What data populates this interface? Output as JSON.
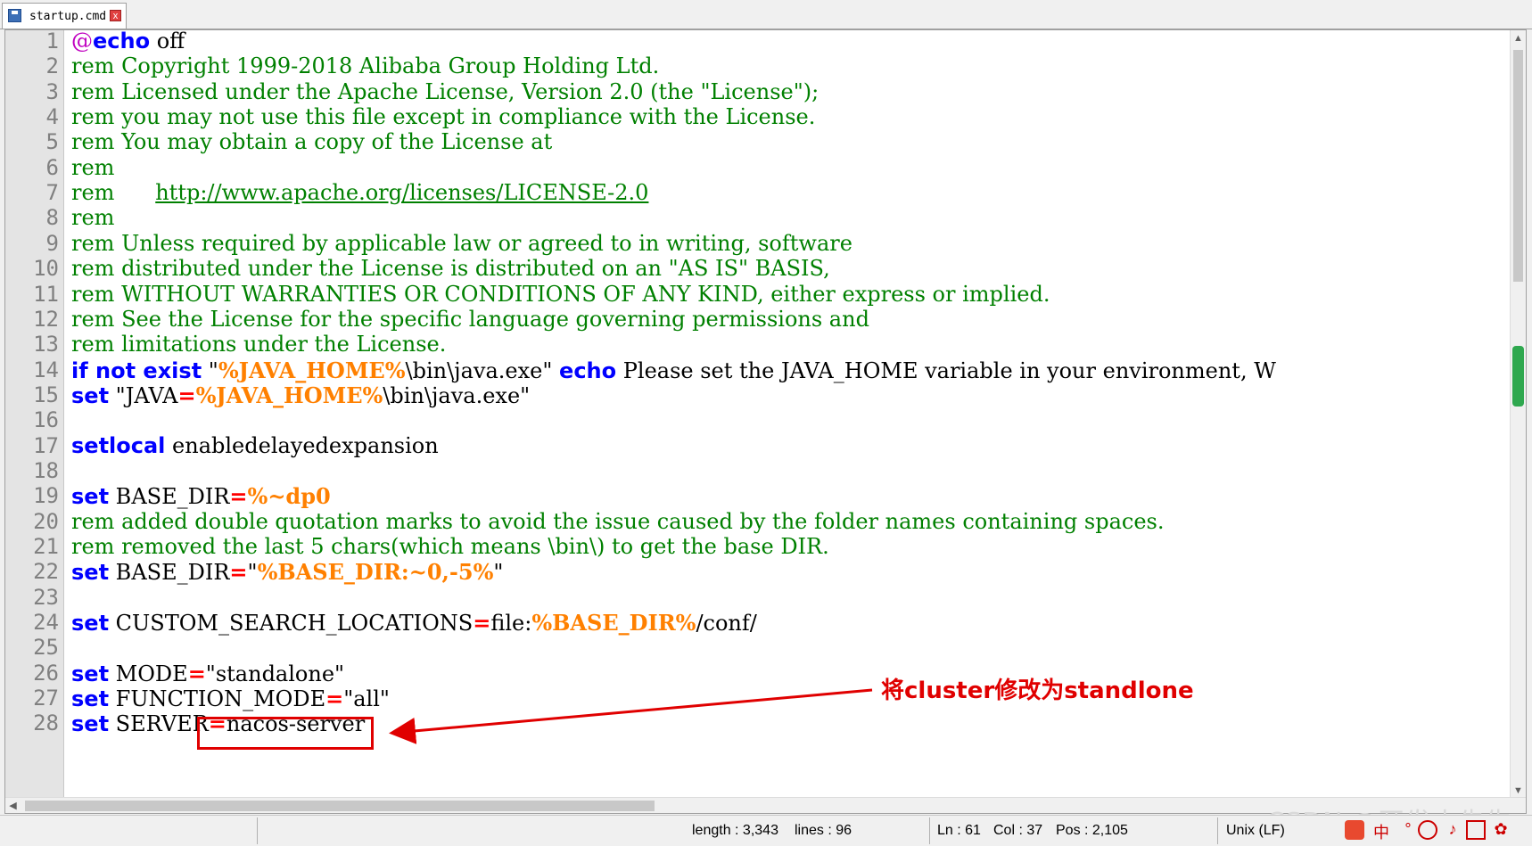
{
  "tab": {
    "label": "startup.cmd",
    "close_glyph": "x"
  },
  "lines": [
    {
      "n": "1",
      "segs": [
        {
          "c": "at",
          "t": "@"
        },
        {
          "c": "kw",
          "t": "echo"
        },
        {
          "c": "pl",
          "t": " off"
        }
      ]
    },
    {
      "n": "2",
      "segs": [
        {
          "c": "cm",
          "t": "rem Copyright 1999-2018 Alibaba Group Holding Ltd."
        }
      ]
    },
    {
      "n": "3",
      "segs": [
        {
          "c": "cm",
          "t": "rem Licensed under the Apache License, Version 2.0 (the \"License\");"
        }
      ]
    },
    {
      "n": "4",
      "segs": [
        {
          "c": "cm",
          "t": "rem you may not use this file except in compliance with the License."
        }
      ]
    },
    {
      "n": "5",
      "segs": [
        {
          "c": "cm",
          "t": "rem You may obtain a copy of the License at"
        }
      ]
    },
    {
      "n": "6",
      "segs": [
        {
          "c": "cm",
          "t": "rem"
        }
      ]
    },
    {
      "n": "7",
      "segs": [
        {
          "c": "cm",
          "t": "rem      "
        },
        {
          "c": "link",
          "t": "http://www.apache.org/licenses/LICENSE-2.0"
        }
      ]
    },
    {
      "n": "8",
      "segs": [
        {
          "c": "cm",
          "t": "rem"
        }
      ]
    },
    {
      "n": "9",
      "segs": [
        {
          "c": "cm",
          "t": "rem Unless required by applicable law or agreed to in writing, software"
        }
      ]
    },
    {
      "n": "10",
      "segs": [
        {
          "c": "cm",
          "t": "rem distributed under the License is distributed on an \"AS IS\" BASIS,"
        }
      ]
    },
    {
      "n": "11",
      "segs": [
        {
          "c": "cm",
          "t": "rem WITHOUT WARRANTIES OR CONDITIONS OF ANY KIND, either express or implied."
        }
      ]
    },
    {
      "n": "12",
      "segs": [
        {
          "c": "cm",
          "t": "rem See the License for the specific language governing permissions and"
        }
      ]
    },
    {
      "n": "13",
      "segs": [
        {
          "c": "cm",
          "t": "rem limitations under the License."
        }
      ]
    },
    {
      "n": "14",
      "segs": [
        {
          "c": "kw",
          "t": "if not exist"
        },
        {
          "c": "pl",
          "t": " \""
        },
        {
          "c": "var",
          "t": "%JAVA_HOME%"
        },
        {
          "c": "pl",
          "t": "\\bin\\java.exe\" "
        },
        {
          "c": "kw",
          "t": "echo"
        },
        {
          "c": "pl",
          "t": " Please set the JAVA_HOME variable in your environment, W"
        }
      ]
    },
    {
      "n": "15",
      "segs": [
        {
          "c": "kw",
          "t": "set"
        },
        {
          "c": "pl",
          "t": " \"JAVA"
        },
        {
          "c": "op",
          "t": "="
        },
        {
          "c": "var",
          "t": "%JAVA_HOME%"
        },
        {
          "c": "pl",
          "t": "\\bin\\java.exe\""
        }
      ]
    },
    {
      "n": "16",
      "segs": []
    },
    {
      "n": "17",
      "segs": [
        {
          "c": "kw",
          "t": "setlocal"
        },
        {
          "c": "pl",
          "t": " enabledelayedexpansion"
        }
      ]
    },
    {
      "n": "18",
      "segs": []
    },
    {
      "n": "19",
      "segs": [
        {
          "c": "kw",
          "t": "set"
        },
        {
          "c": "pl",
          "t": " BASE_DIR"
        },
        {
          "c": "op",
          "t": "="
        },
        {
          "c": "var",
          "t": "%~dp0"
        }
      ]
    },
    {
      "n": "20",
      "segs": [
        {
          "c": "cm",
          "t": "rem added double quotation marks to avoid the issue caused by the folder names containing spaces."
        }
      ]
    },
    {
      "n": "21",
      "segs": [
        {
          "c": "cm",
          "t": "rem removed the last 5 chars(which means \\bin\\) to get the base DIR."
        }
      ]
    },
    {
      "n": "22",
      "segs": [
        {
          "c": "kw",
          "t": "set"
        },
        {
          "c": "pl",
          "t": " BASE_DIR"
        },
        {
          "c": "op",
          "t": "="
        },
        {
          "c": "pl",
          "t": "\""
        },
        {
          "c": "var",
          "t": "%BASE_DIR:~0,-5%"
        },
        {
          "c": "pl",
          "t": "\""
        }
      ]
    },
    {
      "n": "23",
      "segs": []
    },
    {
      "n": "24",
      "segs": [
        {
          "c": "kw",
          "t": "set"
        },
        {
          "c": "pl",
          "t": " CUSTOM_SEARCH_LOCATIONS"
        },
        {
          "c": "op",
          "t": "="
        },
        {
          "c": "pl",
          "t": "file:"
        },
        {
          "c": "var",
          "t": "%BASE_DIR%"
        },
        {
          "c": "pl",
          "t": "/conf/"
        }
      ]
    },
    {
      "n": "25",
      "segs": []
    },
    {
      "n": "26",
      "segs": [
        {
          "c": "kw",
          "t": "set"
        },
        {
          "c": "pl",
          "t": " MODE"
        },
        {
          "c": "op",
          "t": "="
        },
        {
          "c": "pl",
          "t": "\"standalone\""
        }
      ]
    },
    {
      "n": "27",
      "segs": [
        {
          "c": "kw",
          "t": "set"
        },
        {
          "c": "pl",
          "t": " FUNCTION_MODE"
        },
        {
          "c": "op",
          "t": "="
        },
        {
          "c": "pl",
          "t": "\"all\""
        }
      ]
    },
    {
      "n": "28",
      "segs": [
        {
          "c": "kw",
          "t": "set"
        },
        {
          "c": "pl",
          "t": " SERVER"
        },
        {
          "c": "op",
          "t": "="
        },
        {
          "c": "pl",
          "t": "nacos-server"
        }
      ]
    }
  ],
  "annotation": {
    "text": "将cluster修改为standlone",
    "color": "#e00000"
  },
  "status": {
    "length": "length : 3,343",
    "lines": "lines : 96",
    "ln": "Ln : 61",
    "col": "Col : 37",
    "pos": "Pos : 2,105",
    "eol": "Unix (LF)"
  },
  "watermark": "CSDN @开发小先生",
  "colors": {
    "keyword": "#0000ff",
    "variable": "#ff8000",
    "operator": "#ff0000",
    "comment": "#008000",
    "at": "#c000c0"
  }
}
